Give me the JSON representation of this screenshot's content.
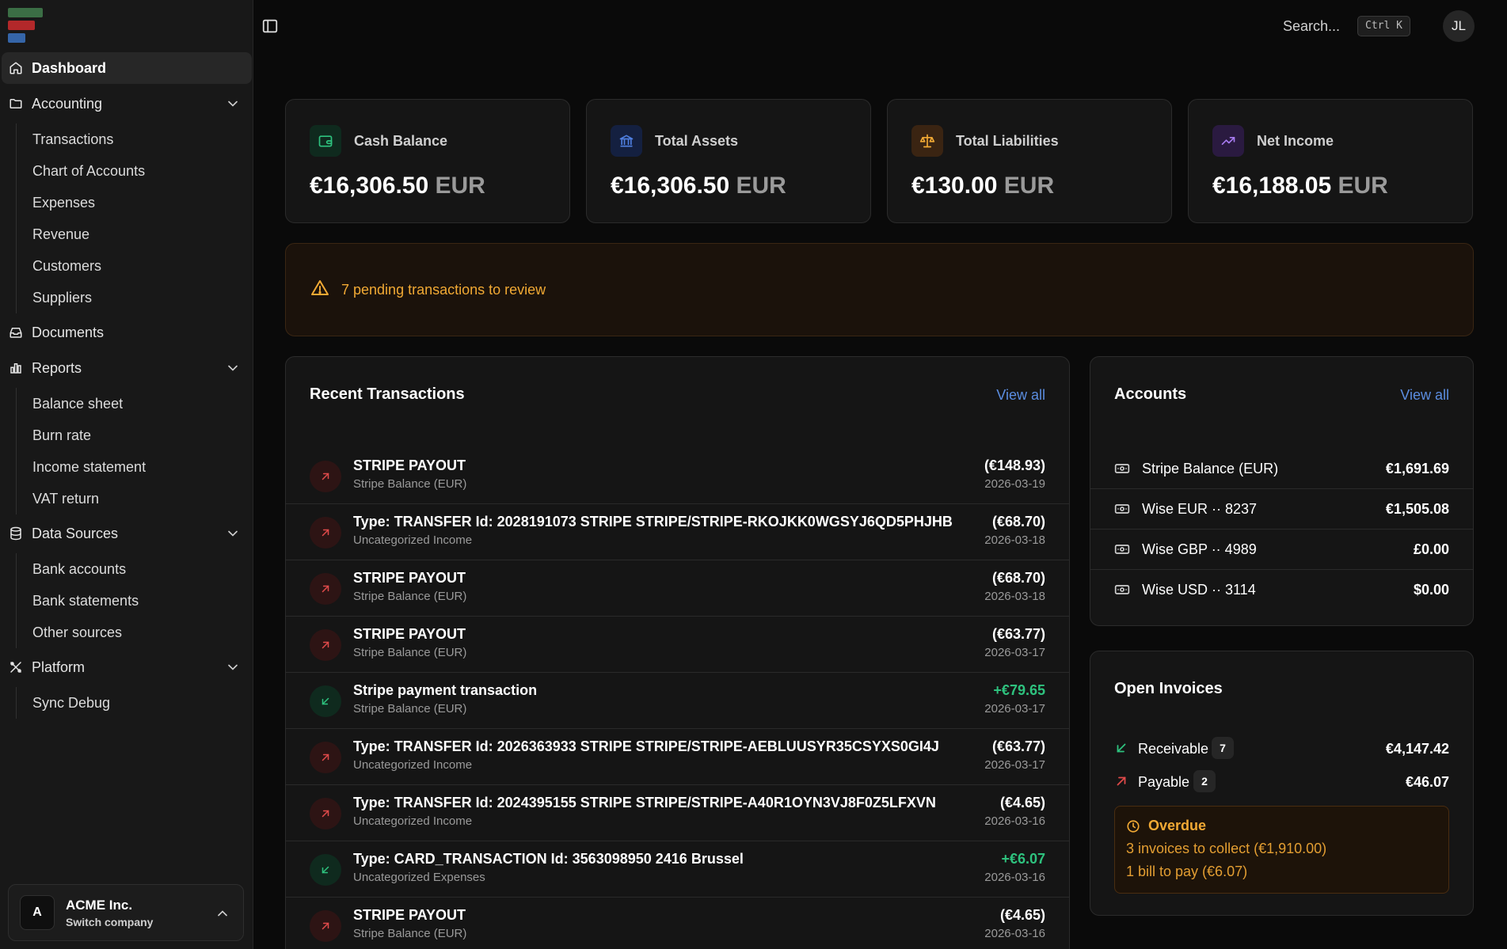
{
  "sidebar": {
    "dashboard": "Dashboard",
    "accounting": {
      "label": "Accounting",
      "items": [
        "Transactions",
        "Chart of Accounts",
        "Expenses",
        "Revenue",
        "Customers",
        "Suppliers"
      ]
    },
    "documents": "Documents",
    "reports": {
      "label": "Reports",
      "items": [
        "Balance sheet",
        "Burn rate",
        "Income statement",
        "VAT return"
      ]
    },
    "data_sources": {
      "label": "Data Sources",
      "items": [
        "Bank accounts",
        "Bank statements",
        "Other sources"
      ]
    },
    "platform": {
      "label": "Platform",
      "items": [
        "Sync Debug"
      ]
    },
    "company": {
      "initial": "A",
      "name": "ACME Inc.",
      "sub": "Switch company"
    }
  },
  "topbar": {
    "search_label": "Search...",
    "shortcut": "Ctrl K",
    "user_initials": "JL"
  },
  "stats": [
    {
      "label": "Cash Balance",
      "value": "€16,306.50",
      "currency": "EUR",
      "icon": "wallet-icon",
      "color": "#2ec27e"
    },
    {
      "label": "Total Assets",
      "value": "€16,306.50",
      "currency": "EUR",
      "icon": "bank-icon",
      "color": "#4f7fe0"
    },
    {
      "label": "Total Liabilities",
      "value": "€130.00",
      "currency": "EUR",
      "icon": "scale-icon",
      "color": "#f1a934"
    },
    {
      "label": "Net Income",
      "value": "€16,188.05",
      "currency": "EUR",
      "icon": "trending-up-icon",
      "color": "#a77bf0"
    }
  ],
  "alert": {
    "text": "7 pending transactions to review",
    "color": "#f1a934"
  },
  "recent": {
    "title": "Recent Transactions",
    "view_all": "View all",
    "rows": [
      {
        "title": "STRIPE PAYOUT",
        "sub": "Stripe Balance (EUR)",
        "amount": "(€148.93)",
        "date": "2026-03-19",
        "dir": "out"
      },
      {
        "title": "Type: TRANSFER Id: 2028191073 STRIPE STRIPE/STRIPE-RKOJKK0WGSYJ6QD5PHJHB",
        "sub": "Uncategorized Income",
        "amount": "(€68.70)",
        "date": "2026-03-18",
        "dir": "out"
      },
      {
        "title": "STRIPE PAYOUT",
        "sub": "Stripe Balance (EUR)",
        "amount": "(€68.70)",
        "date": "2026-03-18",
        "dir": "out"
      },
      {
        "title": "STRIPE PAYOUT",
        "sub": "Stripe Balance (EUR)",
        "amount": "(€63.77)",
        "date": "2026-03-17",
        "dir": "out"
      },
      {
        "title": "Stripe payment transaction",
        "sub": "Stripe Balance (EUR)",
        "amount": "+€79.65",
        "date": "2026-03-17",
        "dir": "in"
      },
      {
        "title": "Type: TRANSFER Id: 2026363933 STRIPE STRIPE/STRIPE-AEBLUUSYR35CSYXS0GI4J",
        "sub": "Uncategorized Income",
        "amount": "(€63.77)",
        "date": "2026-03-17",
        "dir": "out"
      },
      {
        "title": "Type: TRANSFER Id: 2024395155 STRIPE STRIPE/STRIPE-A40R1OYN3VJ8F0Z5LFXVN",
        "sub": "Uncategorized Income",
        "amount": "(€4.65)",
        "date": "2026-03-16",
        "dir": "out"
      },
      {
        "title": "Type: CARD_TRANSACTION Id: 3563098950 2416 Brussel",
        "sub": "Uncategorized Expenses",
        "amount": "+€6.07",
        "date": "2026-03-16",
        "dir": "in"
      },
      {
        "title": "STRIPE PAYOUT",
        "sub": "Stripe Balance (EUR)",
        "amount": "(€4.65)",
        "date": "2026-03-16",
        "dir": "out"
      }
    ]
  },
  "accounts": {
    "title": "Accounts",
    "view_all": "View all",
    "rows": [
      {
        "name": "Stripe Balance (EUR)",
        "amount": "€1,691.69"
      },
      {
        "name": "Wise EUR ·· 8237",
        "amount": "€1,505.08"
      },
      {
        "name": "Wise GBP ·· 4989",
        "amount": "£0.00"
      },
      {
        "name": "Wise USD ·· 3114",
        "amount": "$0.00"
      }
    ]
  },
  "invoices": {
    "title": "Open Invoices",
    "receivable": {
      "label": "Receivable",
      "count": "7",
      "amount": "€4,147.42"
    },
    "payable": {
      "label": "Payable",
      "count": "2",
      "amount": "€46.07"
    },
    "overdue": {
      "title": "Overdue",
      "collect": "3 invoices to collect (€1,910.00)",
      "pay": "1 bill to pay (€6.07)"
    }
  }
}
